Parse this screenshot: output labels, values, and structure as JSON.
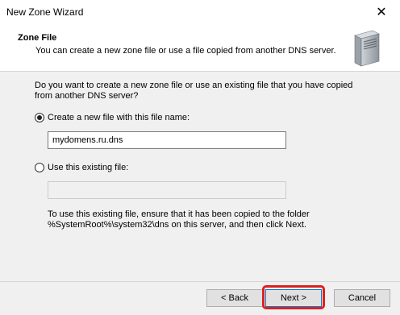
{
  "window": {
    "title": "New Zone Wizard",
    "close_glyph": "✕"
  },
  "header": {
    "title": "Zone File",
    "subtitle": "You can create a new zone file or use a file copied from another DNS server.",
    "icon": "server-icon"
  },
  "body": {
    "question": "Do you want to create a new zone file or use an existing file that you have copied from another DNS server?",
    "option_new": {
      "label": "Create a new file with this file name:",
      "checked": true,
      "value": "mydomens.ru.dns"
    },
    "option_existing": {
      "label": "Use this existing file:",
      "checked": false,
      "value": ""
    },
    "hint": "To use this existing file, ensure that it has been copied to the folder %SystemRoot%\\system32\\dns on this server, and then click Next."
  },
  "buttons": {
    "back": "< Back",
    "next": "Next >",
    "cancel": "Cancel"
  },
  "colors": {
    "highlight": "#e0201b",
    "focus_border": "#0078d7"
  }
}
